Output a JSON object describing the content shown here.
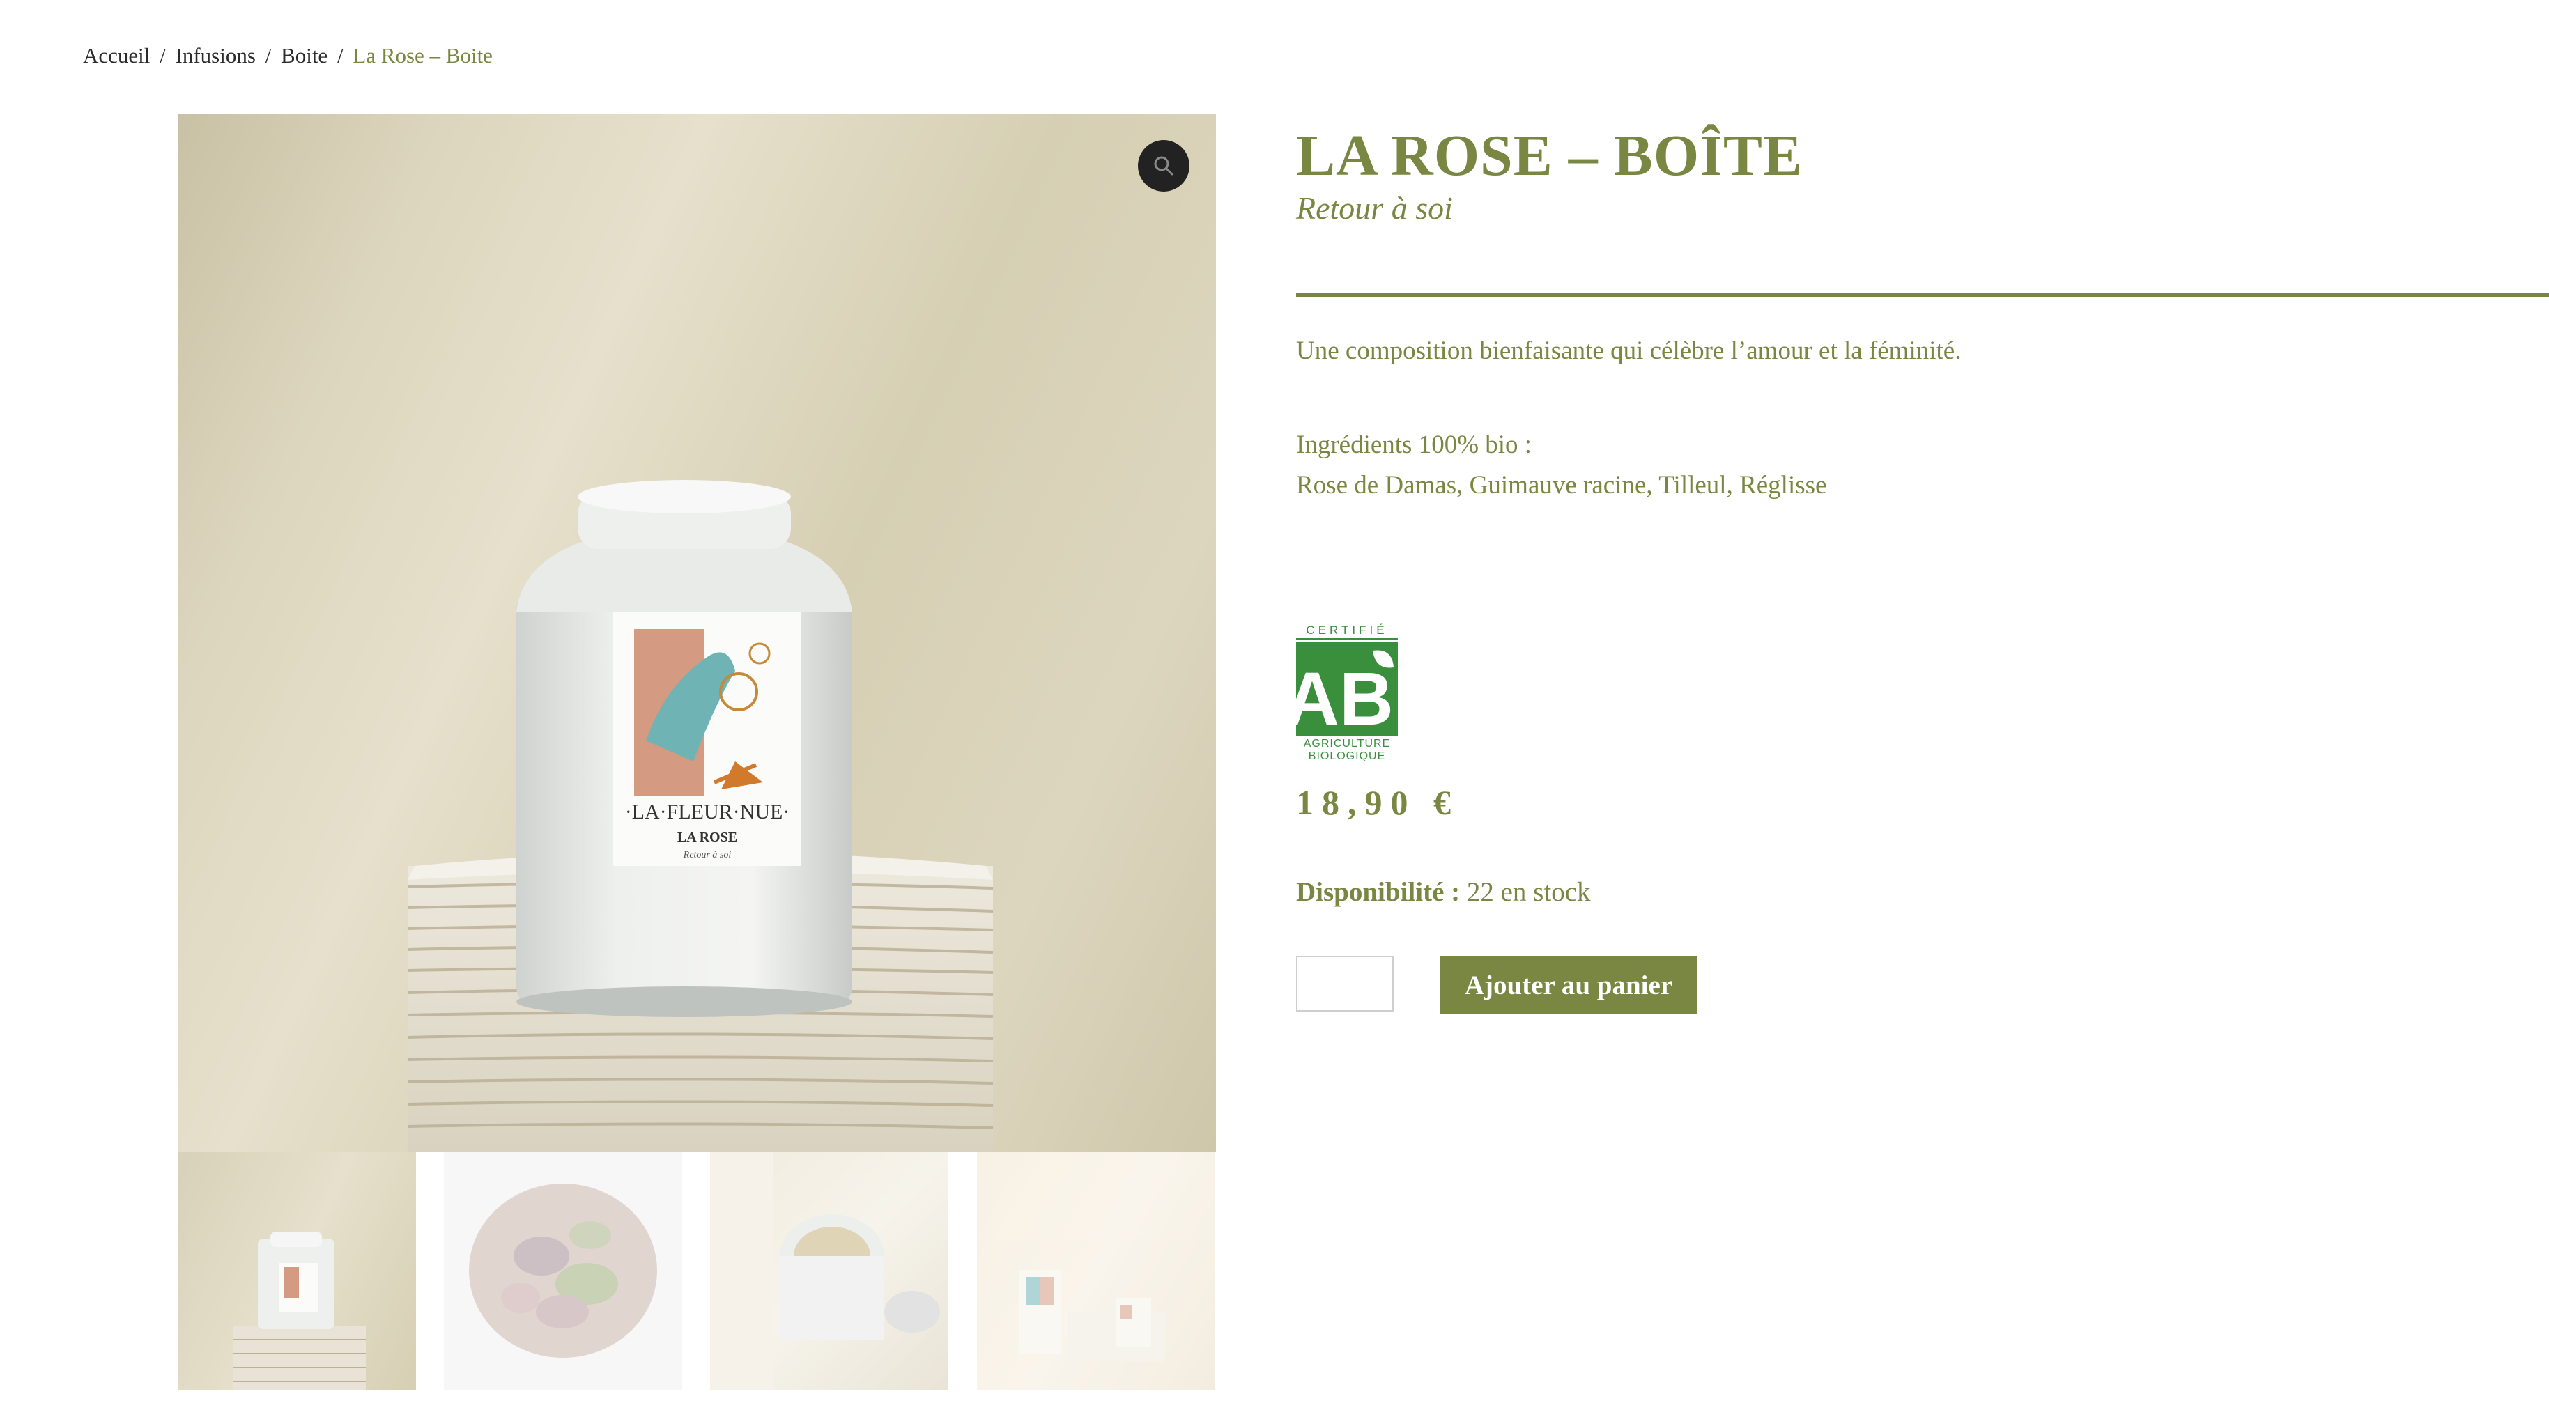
{
  "breadcrumb": {
    "items": [
      "Accueil",
      "Infusions",
      "Boite"
    ],
    "separator": "/",
    "current": "La Rose – Boite"
  },
  "gallery": {
    "main_image": "rose-tin-on-paper-stack",
    "tin_label": {
      "brand": "·LA·FLEUR·NUE·",
      "name": "LA ROSE",
      "tagline": "Retour à soi"
    },
    "thumbnails": [
      "tin-on-paper-stack",
      "dried-rose-petals",
      "tin-top-view",
      "gift-set"
    ],
    "zoom_icon": "magnifier-icon"
  },
  "product": {
    "title": "LA ROSE – BOÎTE",
    "subtitle": "Retour à soi",
    "description": "Une composition bienfaisante qui célèbre l’amour et la féminité.",
    "ingredients_label": "Ingrédients 100% bio :",
    "ingredients_list": "Rose de Damas, Guimauve racine, Tilleul, Réglisse",
    "certification": {
      "top": "CERTIFIÉ",
      "mark": "AB",
      "line1": "AGRICULTURE",
      "line2": "BIOLOGIQUE"
    },
    "price": "18,90 €",
    "availability_label": "Disponibilité :",
    "availability_value": "22 en stock",
    "quantity": "",
    "add_to_cart_label": "Ajouter au panier"
  },
  "colors": {
    "accent": "#7a8742",
    "text_dark": "#2c2c2c",
    "ab_green": "#3a8f3c"
  }
}
